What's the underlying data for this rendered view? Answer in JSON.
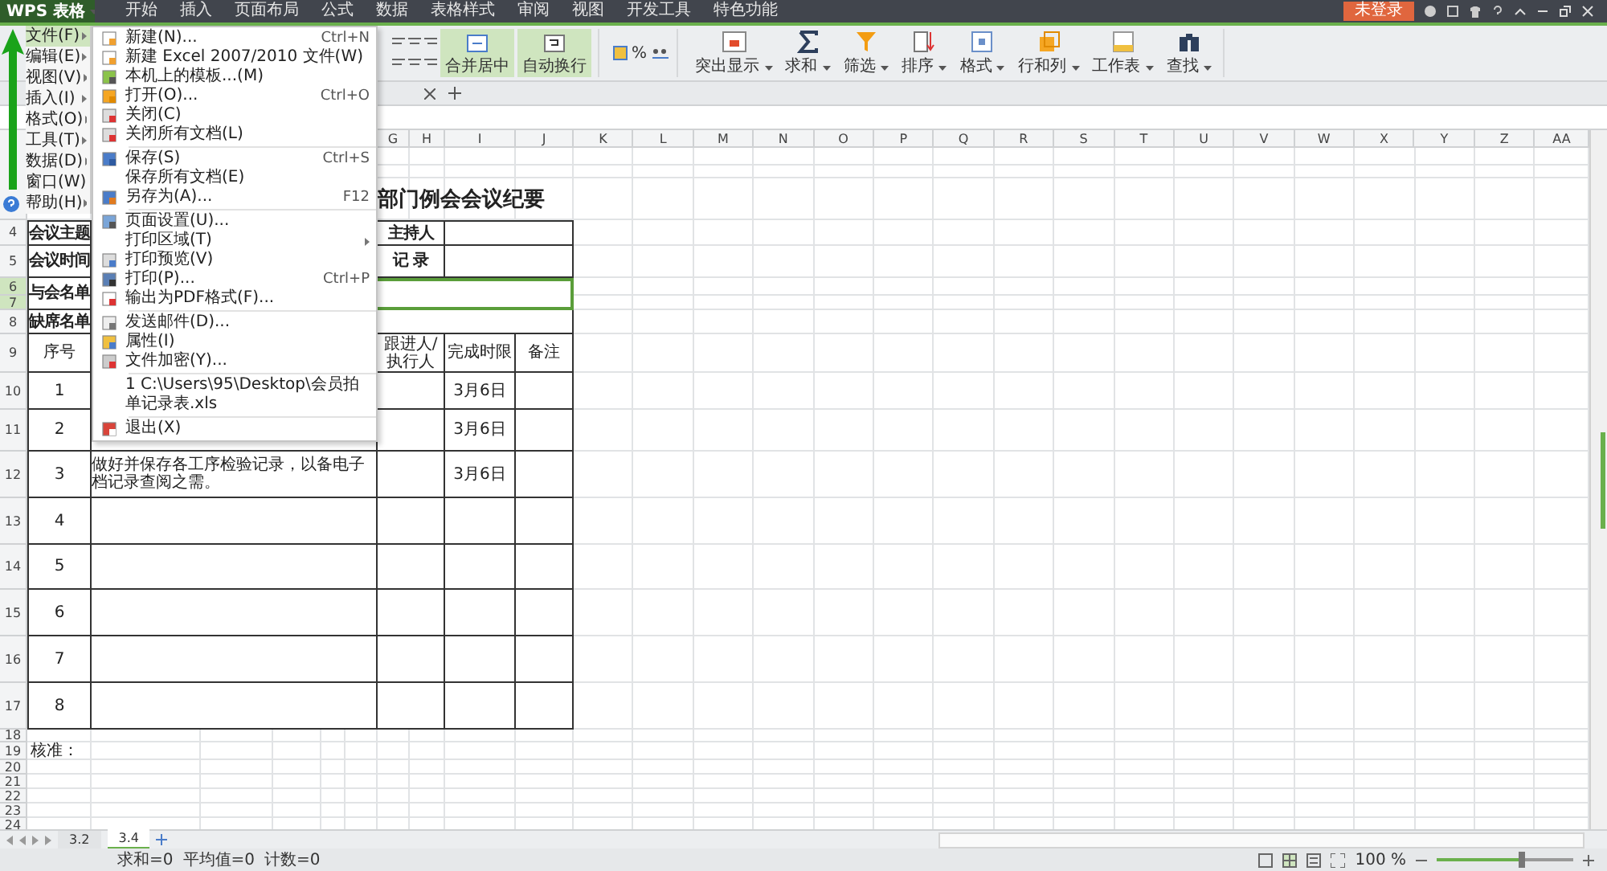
{
  "app": {
    "logo": "WPS 表格"
  },
  "menu_tabs": [
    {
      "label": "开始",
      "selected": false
    },
    {
      "label": "插入",
      "selected": false
    },
    {
      "label": "页面布局",
      "selected": false
    },
    {
      "label": "公式",
      "selected": false
    },
    {
      "label": "数据",
      "selected": false
    },
    {
      "label": "表格样式",
      "selected": false
    },
    {
      "label": "审阅",
      "selected": false
    },
    {
      "label": "视图",
      "selected": false
    },
    {
      "label": "开发工具",
      "selected": false
    },
    {
      "label": "特色功能",
      "selected": false
    }
  ],
  "login_button": "未登录",
  "ribbon": {
    "merge": {
      "label": "合并居中",
      "active": true
    },
    "wrap": {
      "label": "自动换行",
      "active": true
    },
    "percent": "%",
    "tools": [
      {
        "label": "突出显示",
        "kind": "highlight"
      },
      {
        "label": "求和",
        "kind": "sum"
      },
      {
        "label": "筛选",
        "kind": "filter"
      },
      {
        "label": "排序",
        "kind": "sort"
      },
      {
        "label": "格式",
        "kind": "format"
      },
      {
        "label": "行和列",
        "kind": "rowcol"
      },
      {
        "label": "工作表",
        "kind": "sheet"
      },
      {
        "label": "查找",
        "kind": "find"
      }
    ]
  },
  "file_menu": {
    "sidebar": [
      {
        "label": "文件(F)",
        "selected": true
      },
      {
        "label": "编辑(E)",
        "selected": false
      },
      {
        "label": "视图(V)",
        "selected": false
      },
      {
        "label": "插入(I)",
        "selected": false
      },
      {
        "label": "格式(O)",
        "selected": false
      },
      {
        "label": "工具(T)",
        "selected": false
      },
      {
        "label": "数据(D)",
        "selected": false
      },
      {
        "label": "窗口(W)",
        "selected": false
      },
      {
        "label": "帮助(H)",
        "selected": false
      }
    ],
    "items": [
      {
        "kind": "item",
        "label": "新建(N)...",
        "shortcut": "Ctrl+N"
      },
      {
        "kind": "item",
        "label": "新建 Excel 2007/2010 文件(W)"
      },
      {
        "kind": "item",
        "label": "本机上的模板...(M)"
      },
      {
        "kind": "item",
        "label": "打开(O)...",
        "shortcut": "Ctrl+O"
      },
      {
        "kind": "item",
        "label": "关闭(C)"
      },
      {
        "kind": "item",
        "label": "关闭所有文档(L)"
      },
      {
        "kind": "separator"
      },
      {
        "kind": "item",
        "label": "保存(S)",
        "shortcut": "Ctrl+S"
      },
      {
        "kind": "item",
        "label": "保存所有文档(E)"
      },
      {
        "kind": "item",
        "label": "另存为(A)...",
        "shortcut": "F12"
      },
      {
        "kind": "separator"
      },
      {
        "kind": "item",
        "label": "页面设置(U)..."
      },
      {
        "kind": "item",
        "label": "打印区域(T)",
        "submenu": true
      },
      {
        "kind": "item",
        "label": "打印预览(V)"
      },
      {
        "kind": "item",
        "label": "打印(P)...",
        "shortcut": "Ctrl+P"
      },
      {
        "kind": "item",
        "label": "输出为PDF格式(F)..."
      },
      {
        "kind": "separator"
      },
      {
        "kind": "item",
        "label": "发送邮件(D)..."
      },
      {
        "kind": "item",
        "label": "属性(I)"
      },
      {
        "kind": "item",
        "label": "文件加密(Y)..."
      },
      {
        "kind": "separator"
      },
      {
        "kind": "item",
        "label": "1 C:\\Users\\95\\Desktop\\会员拍单记录表.xls"
      },
      {
        "kind": "separator"
      },
      {
        "kind": "item",
        "label": "退出(X)"
      }
    ]
  },
  "sheet": {
    "column_headers": [
      "G",
      "H",
      "I",
      "J",
      "K",
      "L",
      "M",
      "N",
      "O",
      "P",
      "Q",
      "R",
      "S",
      "T",
      "U",
      "V",
      "W",
      "X",
      "Y",
      "Z",
      "AA"
    ],
    "rows": [
      {
        "header": "4",
        "selected": false
      },
      {
        "header": "5",
        "selected": false
      },
      {
        "header": "6",
        "selected": true
      },
      {
        "header": "7",
        "selected": true
      },
      {
        "header": "8",
        "selected": false
      },
      {
        "header": "9",
        "selected": false
      },
      {
        "header": "10",
        "selected": false
      },
      {
        "header": "11",
        "selected": false
      },
      {
        "header": "12",
        "selected": false
      },
      {
        "header": "13",
        "selected": false
      },
      {
        "header": "14",
        "selected": false
      },
      {
        "header": "15",
        "selected": false
      },
      {
        "header": "16",
        "selected": false
      },
      {
        "header": "17",
        "selected": false
      },
      {
        "header": "18",
        "selected": false
      },
      {
        "header": "19",
        "selected": false
      },
      {
        "header": "20",
        "selected": false
      },
      {
        "header": "21",
        "selected": false
      },
      {
        "header": "22",
        "selected": false
      },
      {
        "header": "23",
        "selected": false
      },
      {
        "header": "24",
        "selected": false
      }
    ],
    "form": {
      "title": "部门例会会议纪要",
      "fields": [
        "会议主题",
        "会议时间",
        "与会名单",
        "缺席名单"
      ],
      "side_fields": [
        "主持人",
        "记 录"
      ],
      "columns": [
        "序号",
        "跟进人/执行人",
        "完成时限",
        "备注"
      ],
      "items": [
        {
          "no": "1",
          "deadline": "3月6日"
        },
        {
          "no": "2",
          "deadline": "3月6日"
        },
        {
          "no": "3",
          "content": "做好并保存各工序检验记录，以备电子档记录查阅之需。",
          "deadline": "3月6日"
        },
        {
          "no": "4"
        },
        {
          "no": "5"
        },
        {
          "no": "6"
        },
        {
          "no": "7"
        },
        {
          "no": "8"
        }
      ],
      "footer": "核准："
    }
  },
  "sheet_tabs": [
    {
      "label": "3.2",
      "selected": false
    },
    {
      "label": "3.4",
      "selected": true
    }
  ],
  "status": {
    "sum": "求和=0",
    "average": "平均值=0",
    "count": "计数=0",
    "zoom": "100 %",
    "zoom_slider": {
      "level": 0.62
    }
  }
}
